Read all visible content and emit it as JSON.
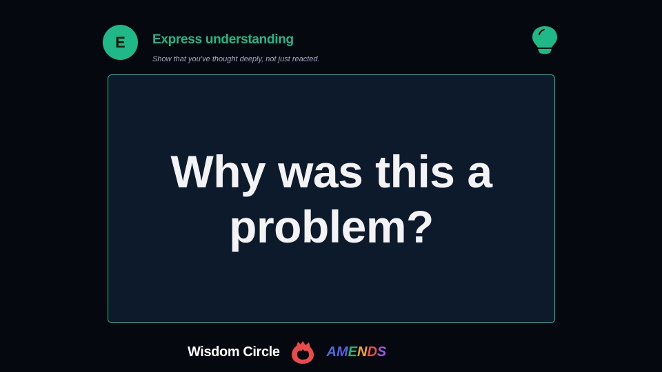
{
  "header": {
    "badge_letter": "E",
    "title": "Express understanding",
    "subtitle": "Show that you’ve thought deeply, not just reacted.",
    "icon": "lightbulb-icon",
    "accent_color": "#1fb886"
  },
  "card": {
    "question": "Why was this a problem?"
  },
  "footer": {
    "brand": "Wisdom Circle",
    "logo_icon": "flame-logo-icon",
    "amends_letters": [
      {
        "char": "A",
        "color": "#4a6fd8"
      },
      {
        "char": "M",
        "color": "#5b62e0"
      },
      {
        "char": "E",
        "color": "#22b573"
      },
      {
        "char": "N",
        "color": "#f5a623"
      },
      {
        "char": "D",
        "color": "#e8504c"
      },
      {
        "char": "S",
        "color": "#9a5bd8"
      }
    ]
  }
}
